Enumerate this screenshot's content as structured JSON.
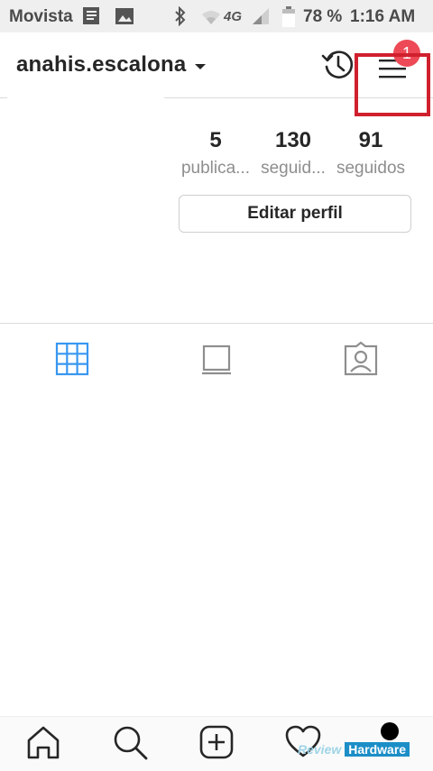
{
  "status_bar": {
    "carrier": "Movista",
    "battery_text": "78 %",
    "time": "1:16 AM",
    "network": "4G"
  },
  "header": {
    "username": "anahis.escalona",
    "menu_badge": "1"
  },
  "profile": {
    "stats": [
      {
        "value": "5",
        "label": "publica..."
      },
      {
        "value": "130",
        "label": "seguid..."
      },
      {
        "value": "91",
        "label": "seguidos"
      }
    ],
    "edit_button": "Editar perfil"
  },
  "tabs": {
    "active": "grid",
    "icons": [
      "grid-icon",
      "feed-icon",
      "tagged-icon"
    ],
    "accent_color": "#3897f0"
  },
  "bottom_nav": {
    "icons": [
      "home-icon",
      "search-icon",
      "add-post-icon",
      "activity-icon",
      "profile-icon"
    ]
  },
  "watermark": {
    "review": "Review",
    "hardware": "Hardware"
  }
}
